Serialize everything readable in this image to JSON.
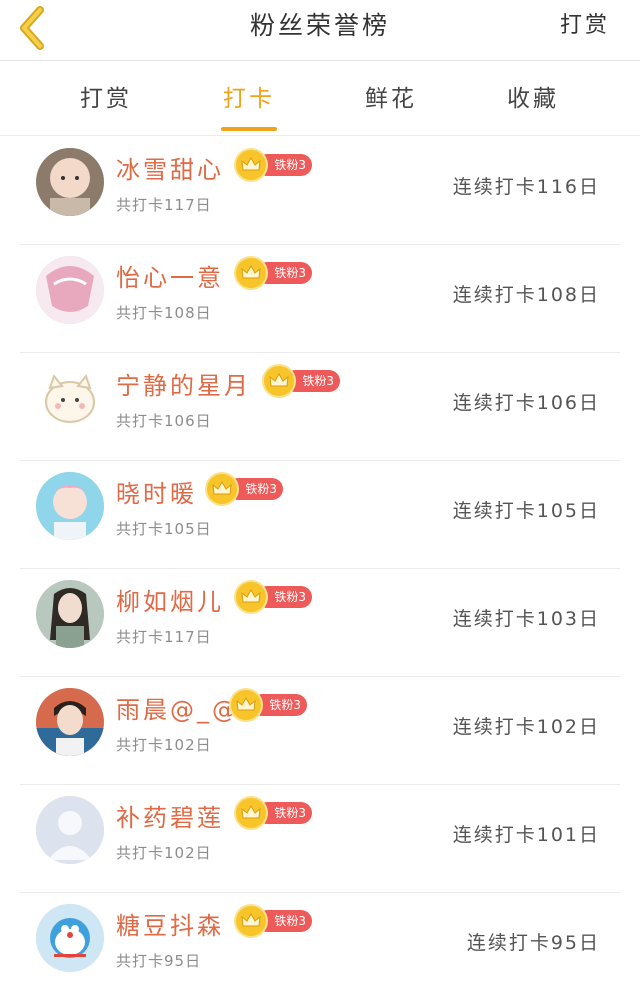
{
  "header": {
    "title": "粉丝荣誉榜",
    "action_label": "打赏"
  },
  "tabs": [
    {
      "label": "打赏",
      "active": false
    },
    {
      "label": "打卡",
      "active": true
    },
    {
      "label": "鲜花",
      "active": false
    },
    {
      "label": "收藏",
      "active": false
    }
  ],
  "colors": {
    "accent": "#f0a21c",
    "name": "#e06a45",
    "badge_red": "#ee5a5a",
    "crown_gold": "#f7c52a"
  },
  "fans": [
    {
      "name": "冰雪甜心",
      "badge": "铁粉3",
      "total": "共打卡117日",
      "streak": "连续打卡116日",
      "avatar": "child-photo"
    },
    {
      "name": "怡心一意",
      "badge": "铁粉3",
      "total": "共打卡108日",
      "streak": "连续打卡108日",
      "avatar": "pink-illustration"
    },
    {
      "name": "宁静的星月",
      "badge": "铁粉3",
      "total": "共打卡106日",
      "streak": "连续打卡106日",
      "avatar": "cartoon-cat"
    },
    {
      "name": "晓时暖",
      "badge": "铁粉3",
      "total": "共打卡105日",
      "streak": "连续打卡105日",
      "avatar": "person-photo"
    },
    {
      "name": "柳如烟儿",
      "badge": "铁粉3",
      "total": "共打卡117日",
      "streak": "连续打卡103日",
      "avatar": "costume-photo"
    },
    {
      "name": "雨晨@_@",
      "badge": "铁粉3",
      "total": "共打卡102日",
      "streak": "连续打卡102日",
      "avatar": "person-photo"
    },
    {
      "name": "补药碧莲",
      "badge": "铁粉3",
      "total": "共打卡102日",
      "streak": "连续打卡101日",
      "avatar": "default-avatar"
    },
    {
      "name": "糖豆抖森",
      "badge": "铁粉3",
      "total": "共打卡95日",
      "streak": "连续打卡95日",
      "avatar": "doraemon"
    }
  ]
}
